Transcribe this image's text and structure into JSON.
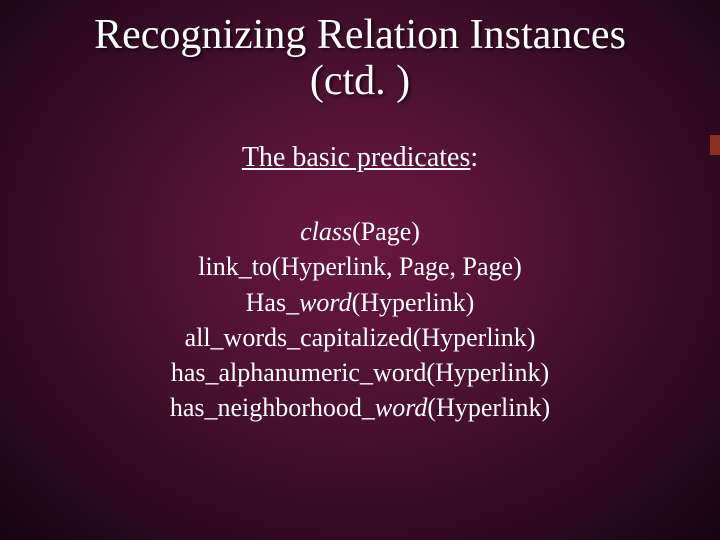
{
  "title_line1": "Recognizing Relation Instances",
  "title_line2": "(ctd. )",
  "subtitle_text": "The basic predicates",
  "subtitle_colon": ":",
  "predicates": {
    "p1_ital": "class",
    "p1_rest": "(Page)",
    "p2": "link_to(Hyperlink, Page, Page)",
    "p3_pre": "Has_",
    "p3_ital": "word",
    "p3_post": "(Hyperlink)",
    "p4": "all_words_capitalized(Hyperlink)",
    "p5": "has_alphanumeric_word(Hyperlink)",
    "p6_pre": "has_neighborhood_",
    "p6_ital": "word",
    "p6_post": "(Hyperlink)"
  }
}
